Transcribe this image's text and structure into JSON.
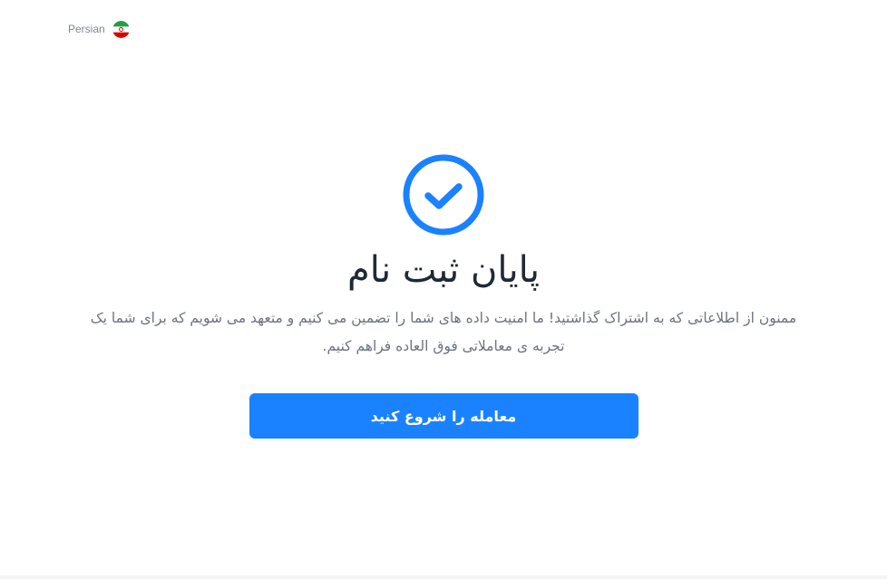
{
  "header": {
    "language_label": "Persian",
    "language_icon": "iran-flag-icon"
  },
  "status": {
    "icon": "check-circle-icon",
    "color": "#1a82ff"
  },
  "content": {
    "title": "پایان ثبت نام",
    "description": "ممنون از اطلاعاتی که به اشتراک گذاشتید! ما امنیت داده های شما را تضمین می کنیم و متعهد می شویم که برای شما یک تجربه ی معاملاتی فوق العاده فراهم کنیم."
  },
  "actions": {
    "start_trading_label": "معامله را شروع کنید",
    "button_color": "#1a82ff"
  }
}
